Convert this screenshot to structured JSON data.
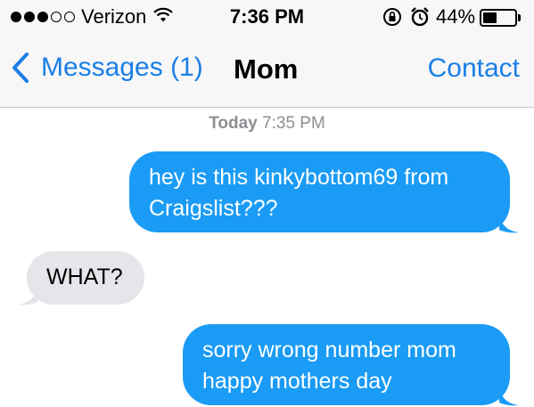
{
  "status_bar": {
    "carrier": "Verizon",
    "signal_bars_filled": 3,
    "signal_bars_total": 5,
    "time": "7:36 PM",
    "battery_percent": "44%",
    "battery_level": 0.44
  },
  "nav": {
    "back_label": "Messages (1)",
    "title": "Mom",
    "contact_label": "Contact"
  },
  "thread": {
    "timestamp_day": "Today",
    "timestamp_time": "7:35 PM",
    "messages": [
      {
        "direction": "sent",
        "text": "hey is this kinkybottom69 from\nCraigslist???"
      },
      {
        "direction": "received",
        "text": "WHAT?"
      },
      {
        "direction": "sent",
        "text": "sorry wrong number mom\nhappy mothers day"
      }
    ]
  },
  "colors": {
    "accent_blue": "#1a7fe6",
    "sent_bubble": "#1a9bf5",
    "received_bubble": "#e5e5ea",
    "timestamp_gray": "#8e8e93"
  }
}
